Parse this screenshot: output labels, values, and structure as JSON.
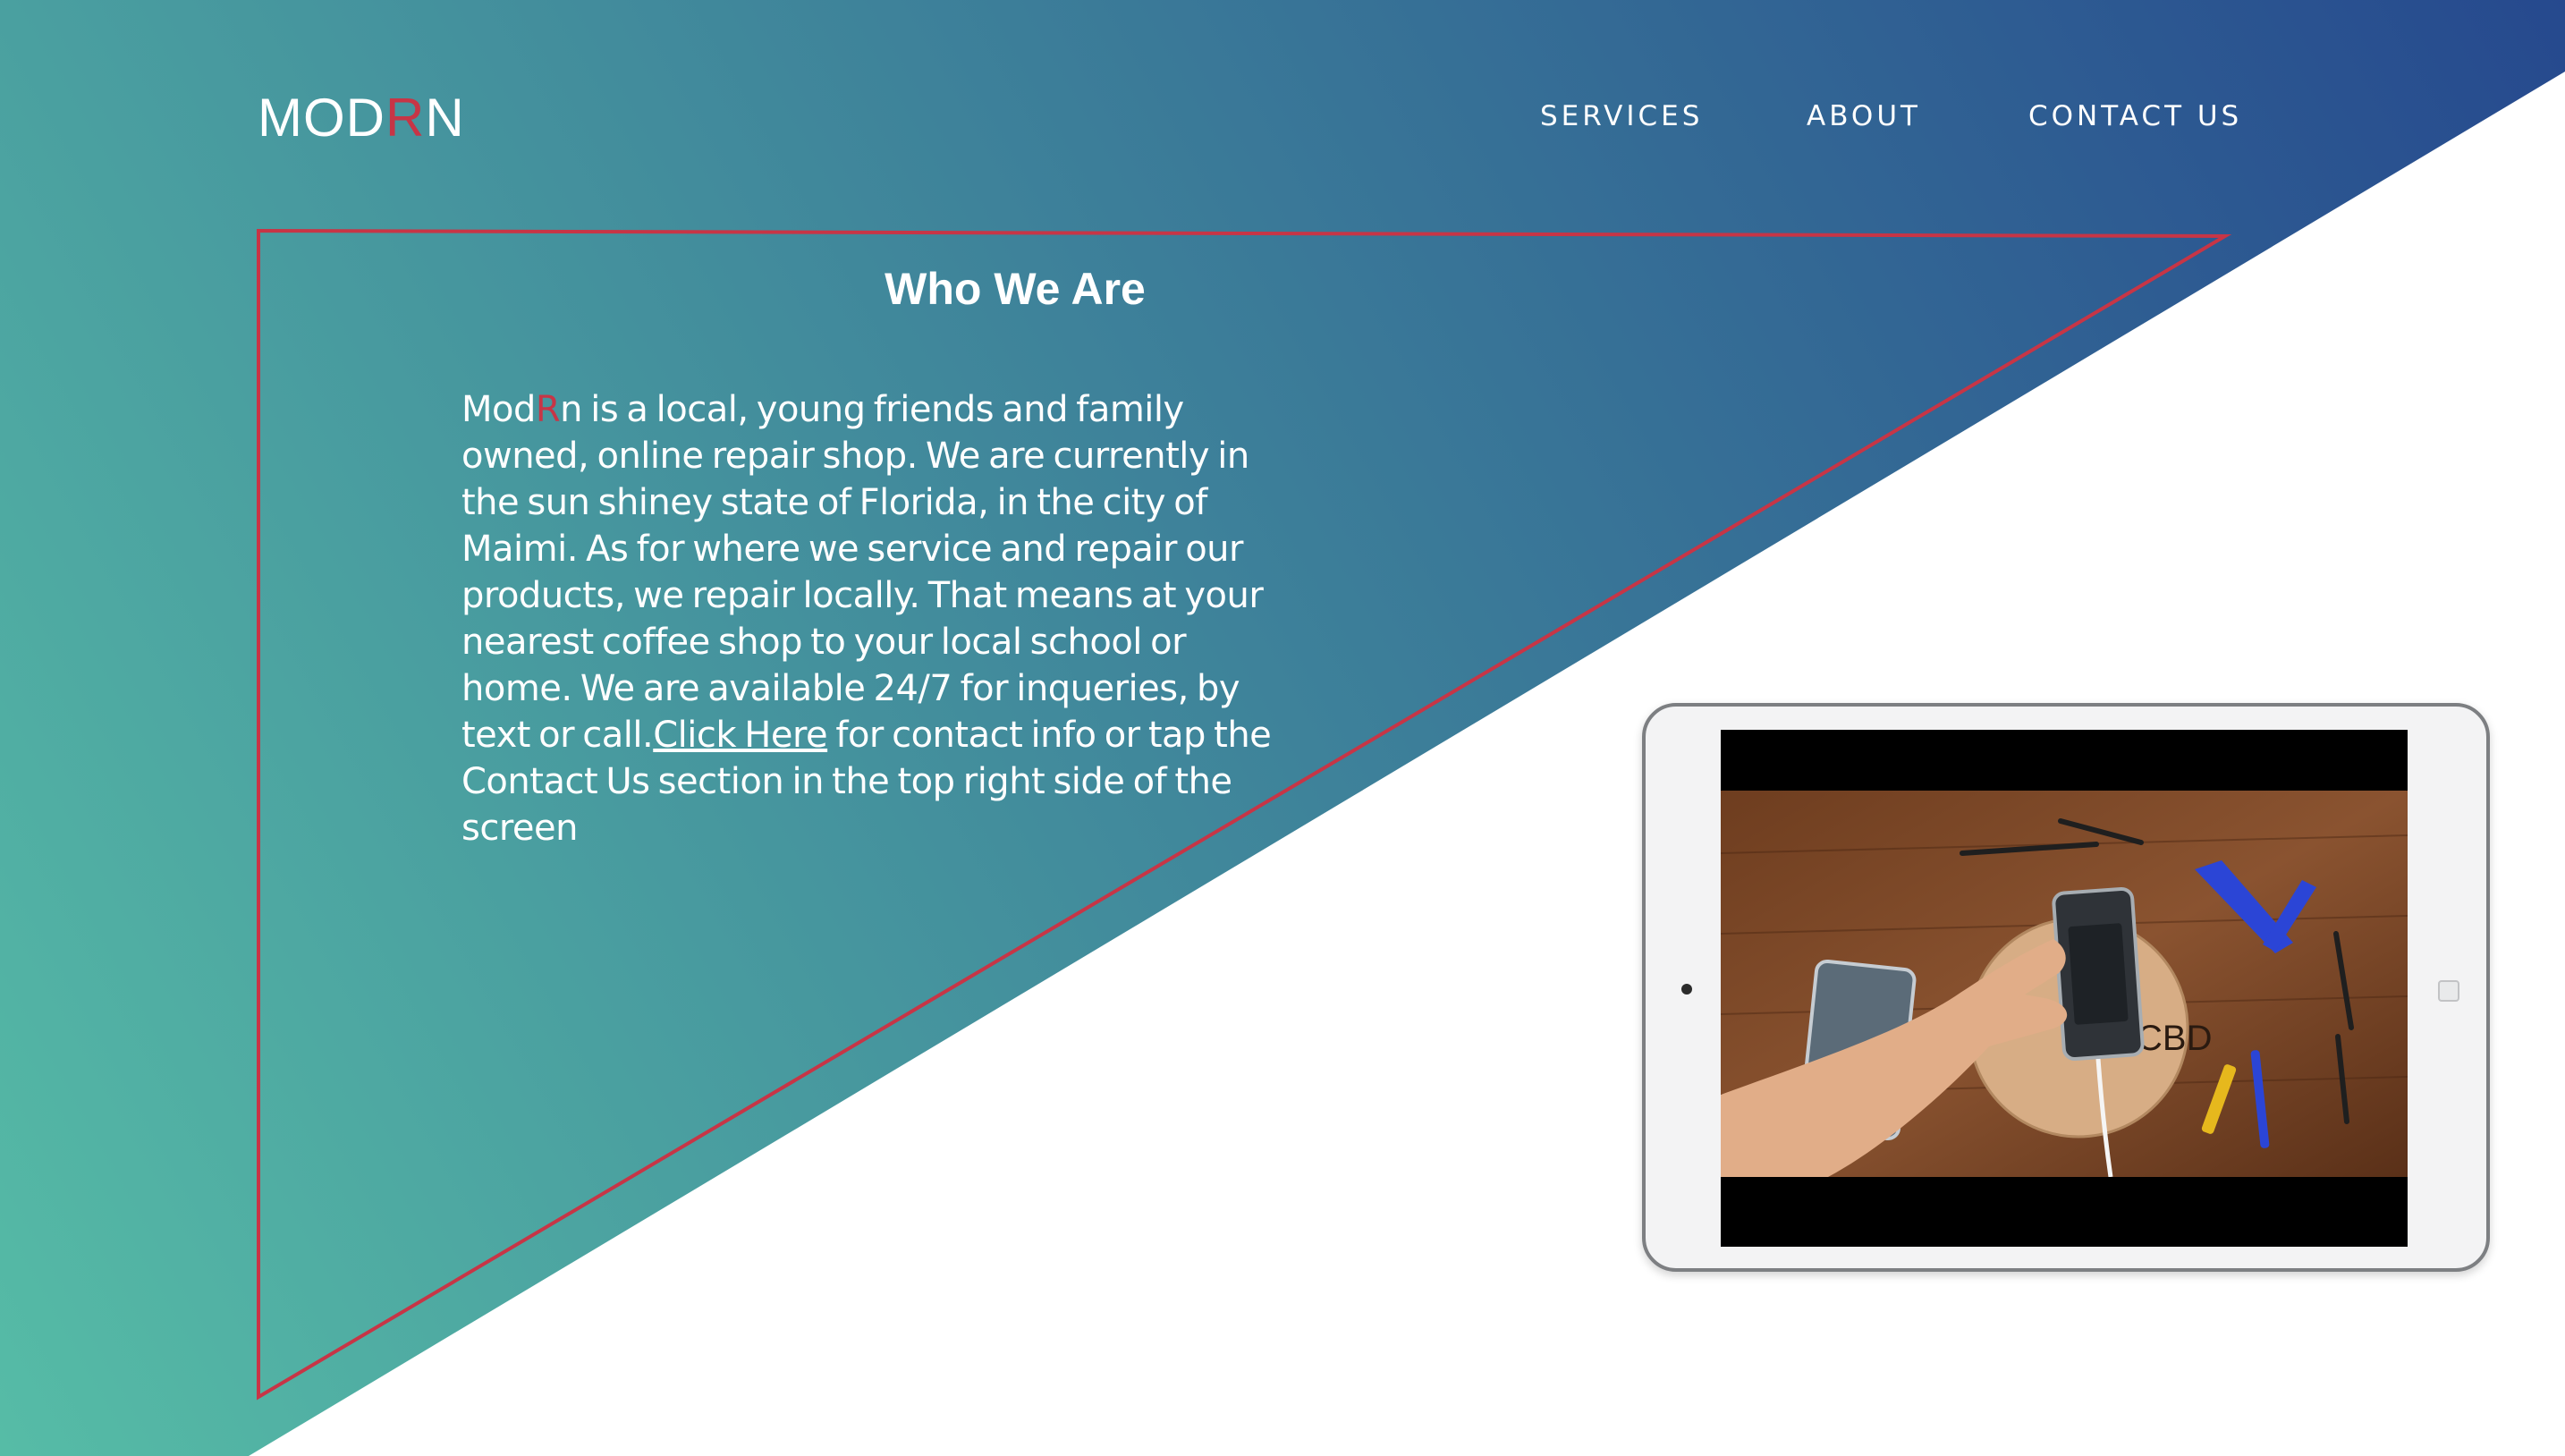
{
  "header": {
    "logo": {
      "before": "MOD",
      "accent": "R",
      "after": "N"
    },
    "nav": [
      {
        "label": "SERVICES"
      },
      {
        "label": "ABOUT"
      },
      {
        "label": "CONTACT US"
      }
    ]
  },
  "about": {
    "title": "Who We Are",
    "brand_before": "Mod",
    "brand_accent": "R",
    "text_part1": "n is a local, young friends and family owned, online repair shop. We are currently in the sun shiney state of Florida, in the city of Maimi. As for where we service and repair our products, we repair locally. That means at your nearest coffee shop to your local school or home. We are available 24/7 for inqueries, by text or call.",
    "link_label": "Click Here",
    "text_part2": " for contact info or tap the Contact Us section in the top right side of the screen"
  },
  "media": {
    "video_overlay_text": "CBD"
  },
  "colors": {
    "gradient_start": "#56bca6",
    "gradient_end": "#26498e",
    "accent": "#c73546",
    "text": "#ffffff"
  }
}
